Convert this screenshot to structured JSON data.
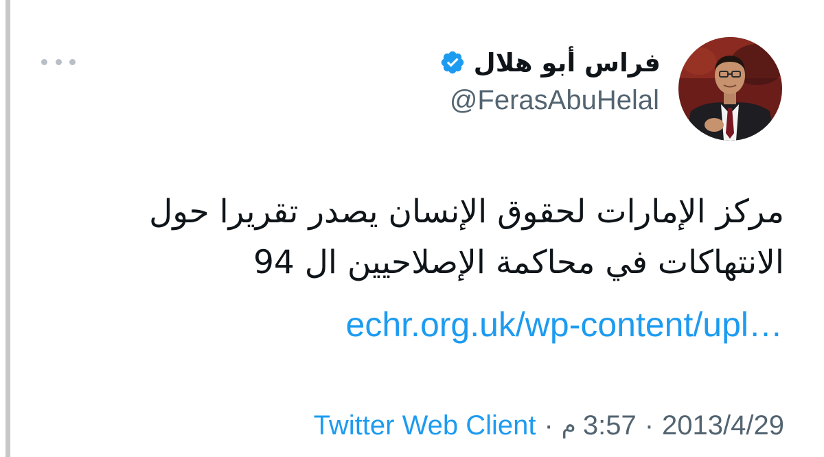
{
  "tweet": {
    "author": {
      "name": "فراس أبو هلال",
      "handle": "@FerasAbuHelal",
      "avatar_icon": "profile-photo",
      "verified_icon": "verified-badge-icon",
      "verified_color": "#1d9bf0"
    },
    "more_icon": "more-options-icon",
    "text": "مركز الإمارات لحقوق الإنسان يصدر تقريرا حول الانتهاكات في محاكمة الإصلاحيين ال 94",
    "link": "echr.org.uk/wp-content/upl…",
    "meta": {
      "date": "2013/4/29",
      "separator": "·",
      "time": "3:57",
      "ampm": "م",
      "client": "Twitter Web Client"
    }
  },
  "colors": {
    "text_primary": "#0f1419",
    "text_secondary": "#536471",
    "link": "#1d9bf0"
  }
}
